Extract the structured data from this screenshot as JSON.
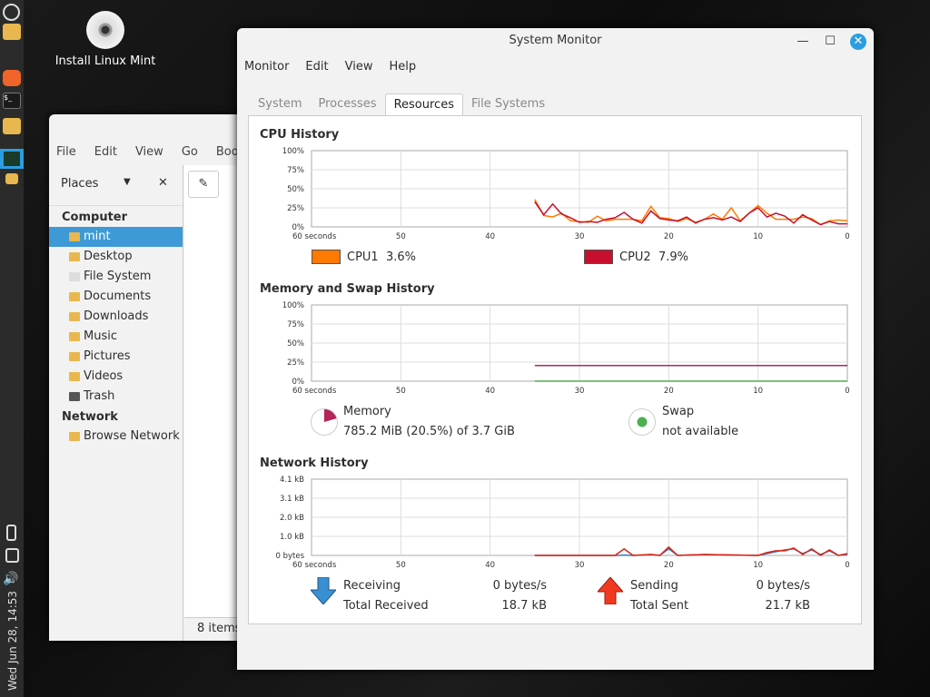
{
  "desktop": {
    "icon_label": "Install Linux Mint",
    "clock": "Wed Jun 28, 14:53"
  },
  "file_manager": {
    "menu": [
      "File",
      "Edit",
      "View",
      "Go",
      "Bookm"
    ],
    "places_label": "Places",
    "sections": [
      {
        "title": "Computer",
        "items": [
          "mint",
          "Desktop",
          "File System",
          "Documents",
          "Downloads",
          "Music",
          "Pictures",
          "Videos",
          "Trash"
        ]
      },
      {
        "title": "Network",
        "items": [
          "Browse Network"
        ]
      }
    ],
    "selected": "mint",
    "status": "8 items"
  },
  "window": {
    "title": "System Monitor",
    "menu": [
      "Monitor",
      "Edit",
      "View",
      "Help"
    ],
    "tabs": [
      "System",
      "Processes",
      "Resources",
      "File Systems"
    ],
    "active_tab": "Resources"
  },
  "cpu": {
    "title": "CPU History",
    "cpu1_label": "CPU1",
    "cpu1_value": "3.6%",
    "cpu2_label": "CPU2",
    "cpu2_value": "7.9%"
  },
  "memory": {
    "title": "Memory and Swap History",
    "mem_label": "Memory",
    "mem_value": "785.2 MiB (20.5%) of 3.7 GiB",
    "swap_label": "Swap",
    "swap_value": "not available"
  },
  "network": {
    "title": "Network History",
    "recv_label": "Receiving",
    "recv_rate": "0 bytes/s",
    "total_recv_label": "Total Received",
    "total_recv": "18.7 kB",
    "send_label": "Sending",
    "send_rate": "0 bytes/s",
    "total_sent_label": "Total Sent",
    "total_sent": "21.7 kB"
  },
  "chart_data": [
    {
      "type": "line",
      "title": "CPU History",
      "x_ticks": [
        "60 seconds",
        "50",
        "40",
        "30",
        "20",
        "10",
        "0"
      ],
      "y_ticks": [
        "100%",
        "75%",
        "50%",
        "25%",
        "0%"
      ],
      "xlim": [
        60,
        0
      ],
      "ylim": [
        0,
        100
      ],
      "grid": true,
      "x": [
        35,
        34,
        33,
        32,
        31,
        30,
        29,
        28,
        27,
        26,
        25,
        24,
        23,
        22,
        21,
        20,
        19,
        18,
        17,
        16,
        15,
        14,
        13,
        12,
        11,
        10,
        9,
        8,
        7,
        6,
        5,
        4,
        3,
        2,
        1,
        0
      ],
      "series": [
        {
          "name": "CPU1",
          "color": "#ff7a00",
          "values": [
            36,
            15,
            13,
            18,
            8,
            7,
            6,
            14,
            8,
            10,
            10,
            10,
            8,
            27,
            12,
            11,
            7,
            11,
            6,
            10,
            17,
            10,
            25,
            8,
            18,
            28,
            18,
            10,
            10,
            10,
            13,
            11,
            3,
            8,
            9,
            8
          ]
        },
        {
          "name": "CPU2",
          "color": "#c8102e",
          "values": [
            33,
            16,
            30,
            17,
            12,
            6,
            7,
            6,
            10,
            12,
            19,
            10,
            5,
            21,
            11,
            9,
            8,
            13,
            5,
            10,
            12,
            9,
            13,
            7,
            18,
            25,
            13,
            18,
            14,
            5,
            16,
            9,
            3,
            7,
            4,
            4
          ]
        }
      ]
    },
    {
      "type": "line",
      "title": "Memory and Swap History",
      "x_ticks": [
        "60 seconds",
        "50",
        "40",
        "30",
        "20",
        "10",
        "0"
      ],
      "y_ticks": [
        "100%",
        "75%",
        "50%",
        "25%",
        "0%"
      ],
      "xlim": [
        60,
        0
      ],
      "ylim": [
        0,
        100
      ],
      "grid": true,
      "x": [
        35,
        0
      ],
      "series": [
        {
          "name": "Memory",
          "color": "#b3245a",
          "values": [
            20.5,
            20.5
          ]
        },
        {
          "name": "Swap",
          "color": "#4caf50",
          "values": [
            0,
            0
          ]
        }
      ]
    },
    {
      "type": "line",
      "title": "Network History",
      "x_ticks": [
        "60 seconds",
        "50",
        "40",
        "30",
        "20",
        "10",
        "0"
      ],
      "y_ticks": [
        "4.1 kB",
        "3.1 kB",
        "2.0 kB",
        "1.0 kB",
        "0 bytes"
      ],
      "xlim": [
        60,
        0
      ],
      "ylim": [
        0,
        4.1
      ],
      "grid": true,
      "x": [
        35,
        30,
        26,
        25,
        24,
        22,
        21,
        20,
        19,
        16,
        10,
        9,
        8,
        7,
        6,
        5,
        4,
        3,
        2,
        1,
        0
      ],
      "series": [
        {
          "name": "Receiving",
          "color": "#2f7fc1",
          "values": [
            0,
            0,
            0,
            0.02,
            0,
            0.05,
            0,
            0.35,
            0,
            0.05,
            0,
            0.1,
            0.2,
            0.3,
            0.35,
            0.1,
            0.3,
            0.05,
            0.25,
            0,
            0.05
          ]
        },
        {
          "name": "Sending",
          "color": "#e02010",
          "values": [
            0,
            0,
            0,
            0.35,
            0,
            0.05,
            0,
            0.45,
            0,
            0.05,
            0,
            0.15,
            0.25,
            0.25,
            0.4,
            0.05,
            0.35,
            0,
            0.3,
            0,
            0.1
          ]
        }
      ]
    }
  ]
}
